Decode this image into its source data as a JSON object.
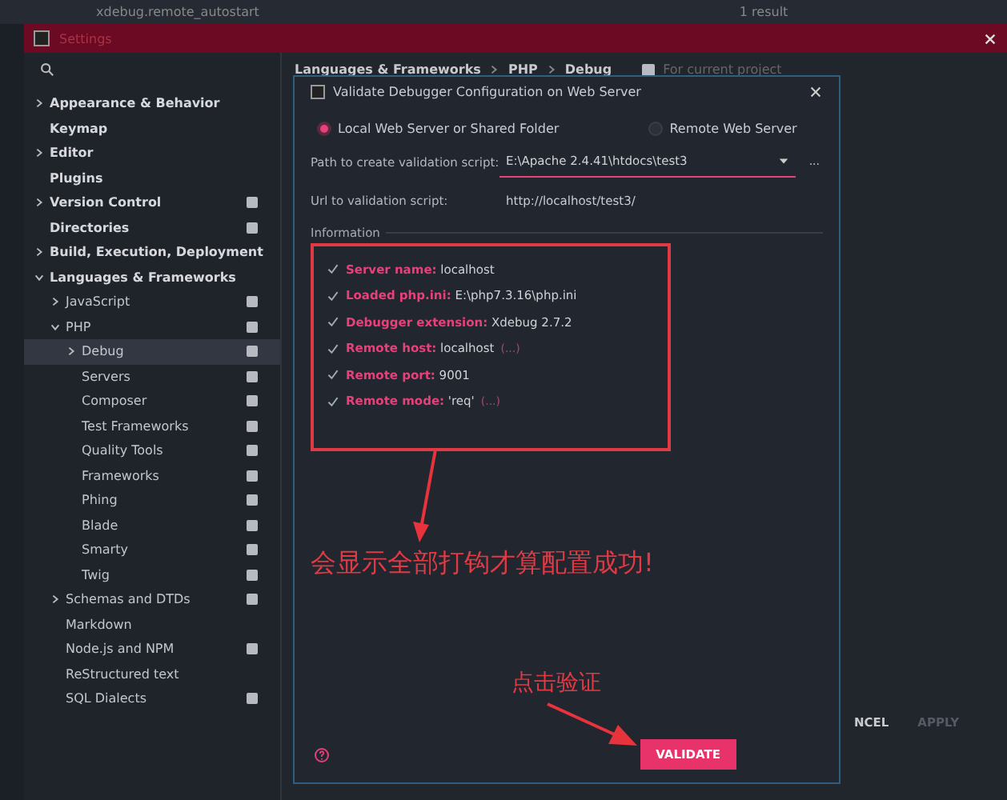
{
  "editor_strip": {
    "search": "xdebug.remote_autostart",
    "result": "1 result"
  },
  "window": {
    "title": "Settings"
  },
  "sidebar": {
    "items": [
      {
        "label": "Appearance & Behavior",
        "expanded": false,
        "scoped": false,
        "selected": false
      },
      {
        "label": "Keymap",
        "scoped": false,
        "selected": false
      },
      {
        "label": "Editor",
        "expanded": false,
        "scoped": false,
        "selected": false
      },
      {
        "label": "Plugins",
        "scoped": false,
        "selected": false
      },
      {
        "label": "Version Control",
        "expanded": false,
        "scoped": true,
        "selected": false
      },
      {
        "label": "Directories",
        "scoped": true,
        "selected": false
      },
      {
        "label": "Build, Execution, Deployment",
        "expanded": false,
        "scoped": false,
        "selected": false
      },
      {
        "label": "Languages & Frameworks",
        "expanded": true,
        "scoped": false,
        "selected": false,
        "children": [
          {
            "label": "JavaScript",
            "expanded": false,
            "scoped": true,
            "selected": false
          },
          {
            "label": "PHP",
            "expanded": true,
            "scoped": true,
            "selected": false,
            "children": [
              {
                "label": "Debug",
                "expanded": false,
                "scoped": true,
                "selected": true
              },
              {
                "label": "Servers",
                "scoped": true,
                "selected": false
              },
              {
                "label": "Composer",
                "scoped": true,
                "selected": false
              },
              {
                "label": "Test Frameworks",
                "scoped": true,
                "selected": false
              },
              {
                "label": "Quality Tools",
                "scoped": true,
                "selected": false
              },
              {
                "label": "Frameworks",
                "scoped": true,
                "selected": false
              },
              {
                "label": "Phing",
                "scoped": true,
                "selected": false
              },
              {
                "label": "Blade",
                "scoped": true,
                "selected": false
              },
              {
                "label": "Smarty",
                "scoped": true,
                "selected": false
              },
              {
                "label": "Twig",
                "scoped": true,
                "selected": false
              }
            ]
          },
          {
            "label": "Schemas and DTDs",
            "expanded": false,
            "scoped": true,
            "selected": false
          },
          {
            "label": "Markdown",
            "scoped": false,
            "selected": false
          },
          {
            "label": "Node.js and NPM",
            "scoped": true,
            "selected": false
          },
          {
            "label": "ReStructured text",
            "scoped": false,
            "selected": false
          },
          {
            "label": "SQL Dialects",
            "scoped": true,
            "selected": false
          }
        ]
      }
    ]
  },
  "breadcrumb": [
    "Languages & Frameworks",
    "PHP",
    "Debug"
  ],
  "scope_hint": "For current project",
  "footer_buttons": [
    {
      "label": "NCEL",
      "disabled": false
    },
    {
      "label": "APPLY",
      "disabled": true
    }
  ],
  "dialog": {
    "title": "Validate Debugger Configuration on Web Server",
    "radios": [
      {
        "label": "Local Web Server or Shared Folder",
        "selected": true
      },
      {
        "label": "Remote Web Server",
        "selected": false
      }
    ],
    "path_label": "Path to create validation script:",
    "path_value": "E:\\Apache 2.4.41\\htdocs\\test3",
    "browse": "...",
    "url_label": "Url to validation script:",
    "url_value": "http://localhost/test3/",
    "info_title": "Information",
    "info": [
      {
        "label": "Server name:",
        "value": "localhost"
      },
      {
        "label": "Loaded php.ini:",
        "value": "E:\\php7.3.16\\php.ini"
      },
      {
        "label": "Debugger extension:",
        "value": "Xdebug 2.7.2"
      },
      {
        "label": "Remote host:",
        "value": "localhost",
        "more": "(...)"
      },
      {
        "label": "Remote port:",
        "value": "9001"
      },
      {
        "label": "Remote mode:",
        "value": "'req'",
        "more": "(...)"
      }
    ],
    "validate": "VALIDATE"
  },
  "annotations": {
    "result_note": "会显示全部打钩才算配置成功!",
    "click_note": "点击验证"
  }
}
